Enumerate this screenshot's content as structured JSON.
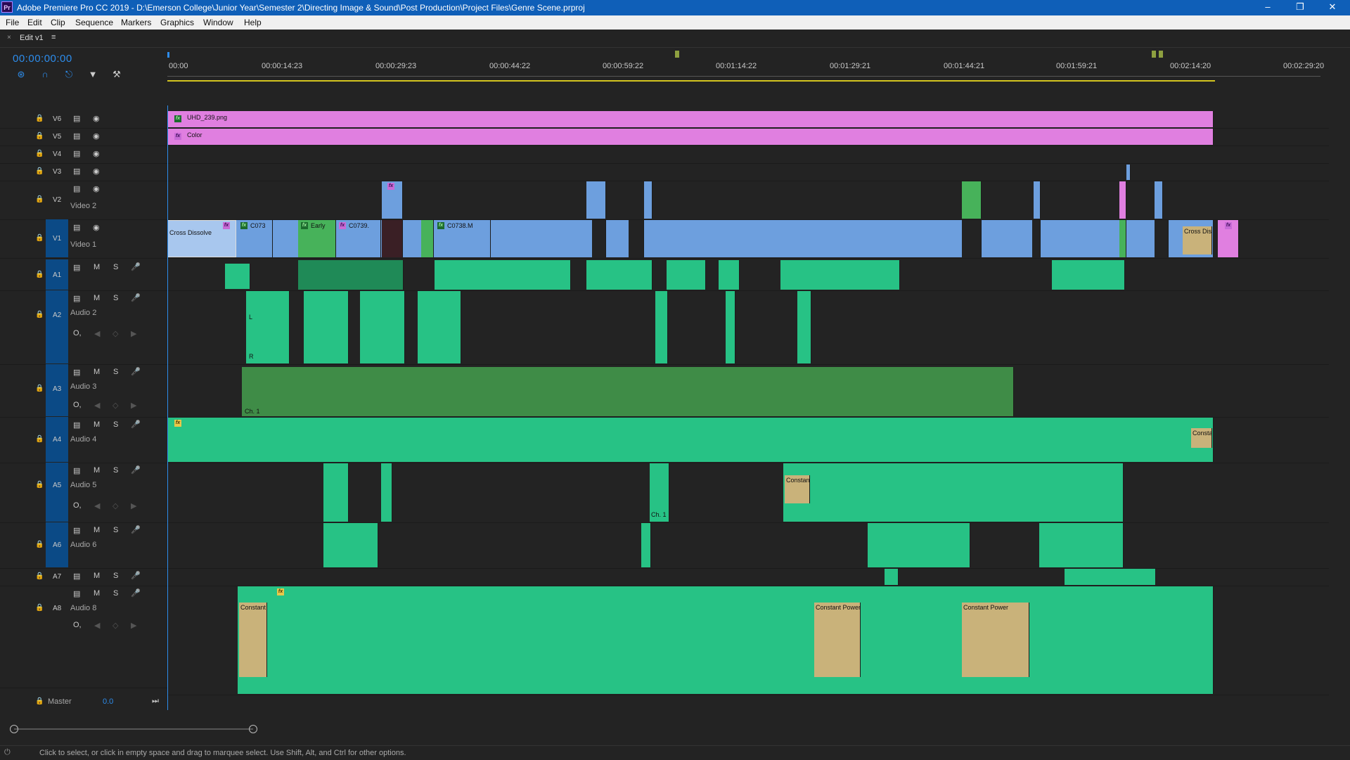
{
  "window": {
    "title": "Adobe Premiere Pro CC 2019 - D:\\Emerson College\\Junior Year\\Semester 2\\Directing Image & Sound\\Post Production\\Project Files\\Genre Scene.prproj",
    "app_icon": "Pr"
  },
  "menu": [
    "File",
    "Edit",
    "Clip",
    "Sequence",
    "Markers",
    "Graphics",
    "Window",
    "Help"
  ],
  "tab": {
    "label": "Edit v1"
  },
  "timecode": "00:00:00:00",
  "ruler": [
    "00:00",
    "00:00:14:23",
    "00:00:29:23",
    "00:00:44:22",
    "00:00:59:22",
    "00:01:14:22",
    "00:01:29:21",
    "00:01:44:21",
    "00:01:59:21",
    "00:02:14:20",
    "00:02:29:20"
  ],
  "tracks": {
    "video": [
      {
        "id": "V6"
      },
      {
        "id": "V5"
      },
      {
        "id": "V4"
      },
      {
        "id": "V3"
      },
      {
        "id": "V2",
        "name": "Video 2"
      },
      {
        "id": "V1",
        "name": "Video 1"
      }
    ],
    "audio": [
      {
        "id": "A1"
      },
      {
        "id": "A2",
        "name": "Audio 2"
      },
      {
        "id": "A3",
        "name": "Audio 3"
      },
      {
        "id": "A4",
        "name": "Audio 4"
      },
      {
        "id": "A5",
        "name": "Audio 5"
      },
      {
        "id": "A6",
        "name": "Audio 6"
      },
      {
        "id": "A7"
      },
      {
        "id": "A8",
        "name": "Audio 8"
      }
    ],
    "master": {
      "label": "Master",
      "value": "0.0"
    },
    "buttons": {
      "mute": "M",
      "solo": "S",
      "channel": "O,"
    }
  },
  "clips": {
    "v6": "UHD_239.png",
    "v5": "Color",
    "v1": [
      "Cross Dissolve",
      "C073",
      "Early",
      "C0739.",
      "C0738.M",
      "Cross Diss"
    ],
    "audio_labels": {
      "l": "L",
      "r": "R",
      "ch1": "Ch. 1",
      "constant": "Constant",
      "constant_p": "Constant P",
      "constant_power": "Constant Power",
      "consta": "Consta"
    }
  },
  "status": "Click to select, or click in empty space and drag to marquee select. Use Shift, Alt, and Ctrl for other options."
}
